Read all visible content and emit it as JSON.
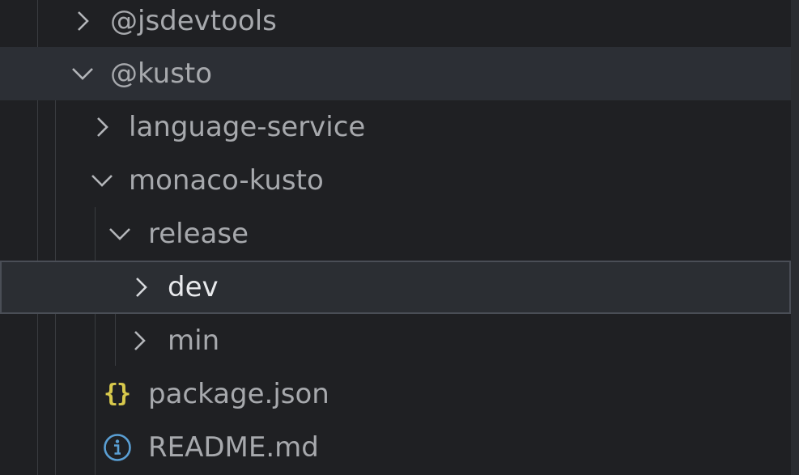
{
  "explorer": {
    "items": [
      {
        "label": "@jsdevtools",
        "kind": "folder",
        "expanded": false
      },
      {
        "label": "@kusto",
        "kind": "folder",
        "expanded": true
      },
      {
        "label": "language-service",
        "kind": "folder",
        "expanded": false
      },
      {
        "label": "monaco-kusto",
        "kind": "folder",
        "expanded": true
      },
      {
        "label": "release",
        "kind": "folder",
        "expanded": true
      },
      {
        "label": "dev",
        "kind": "folder",
        "expanded": false,
        "focused": true
      },
      {
        "label": "min",
        "kind": "folder",
        "expanded": false
      },
      {
        "label": "package.json",
        "kind": "file",
        "icon": "json-braces-icon",
        "icon_text": "{}"
      },
      {
        "label": "README.md",
        "kind": "file",
        "icon": "info-icon"
      }
    ]
  },
  "colors": {
    "background": "#1f2023",
    "hover_row": "#2c2f35",
    "focus_border": "#4a4e56",
    "text": "#a7a9ad",
    "text_focused": "#e8e9ec",
    "json_icon": "#d8c94c",
    "info_icon": "#5a9fd4"
  }
}
